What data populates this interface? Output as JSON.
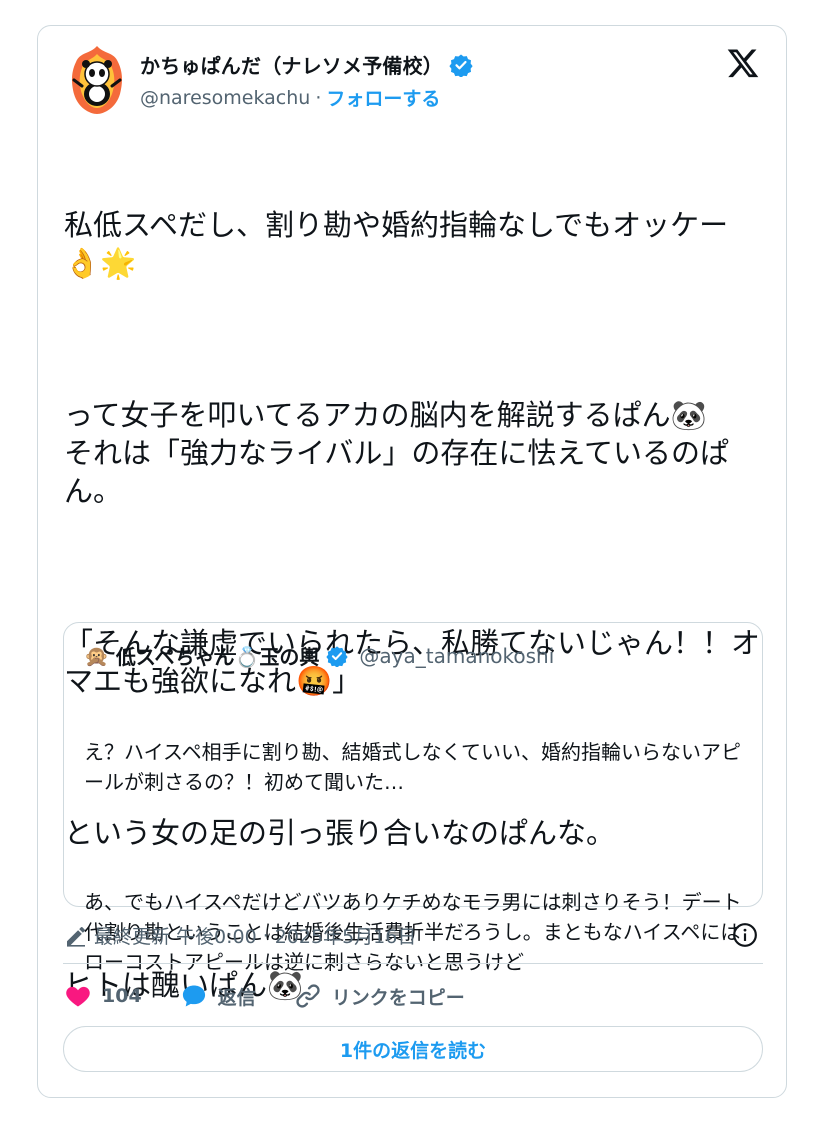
{
  "author": {
    "name": "かちゅぱんだ（ナレソメ予備校）",
    "handle": "@naresomekachu",
    "separator": "·",
    "follow_label": "フォローする"
  },
  "tweet": {
    "paragraphs": [
      "私低スペだし、割り勘や婚約指輪なしでもオッケー👌🌟",
      "って女子を叩いてるアカの脳内を解説するぱん🐼\nそれは「強力なライバル」の存在に怯えているのぱん。",
      "「そんな謙虚でいられたら、私勝てないじゃん！！オマエも強欲になれ🤬」",
      "という女の足の引っ張り合いなのぱんな。",
      "ヒトは醜いぱん🐼"
    ]
  },
  "quote": {
    "avatar_emoji": "🙊",
    "name": "低スペちゃん💍玉の輿",
    "handle": "@aya_tamanokoshi",
    "paragraphs": [
      "え？ハイスペ相手に割り勘、結婚式しなくていい、婚約指輪いらないアピールが刺さるの？！初めて聞いた…",
      "あ、でもハイスペだけどバツありケチめなモラ男には刺さりそう！デート代割り勘ということは結婚後生活費折半だろうし。まともなハイスペにはローコストアピールは逆に刺さらないと思うけど"
    ]
  },
  "meta": {
    "edited_label": "最終更新",
    "time": "午後0:00",
    "separator": "·",
    "date": "2025年5月16日"
  },
  "actions": {
    "likes_count": "104",
    "reply_label": "返信",
    "copy_link_label": "リンクをコピー"
  },
  "read_replies_label": "1件の返信を読む",
  "colors": {
    "accent": "#1d9bf0",
    "like": "#f91880",
    "muted": "#536471",
    "border": "#cfd9de"
  },
  "icons": {
    "verified": "verified-badge-icon",
    "logo": "x-logo-icon",
    "edit": "pencil-icon",
    "info": "info-icon",
    "like": "heart-icon",
    "reply": "speech-bubble-icon",
    "link": "link-icon"
  }
}
